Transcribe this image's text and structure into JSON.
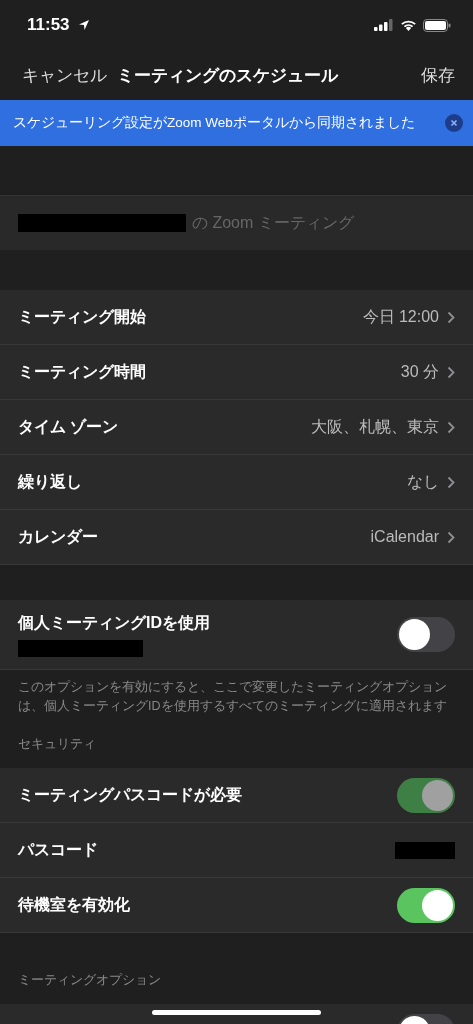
{
  "status_bar": {
    "time": "11:53"
  },
  "nav": {
    "cancel": "キャンセル",
    "title": "ミーティングのスケジュール",
    "save": "保存"
  },
  "banner": {
    "text": "スケジューリング設定がZoom Webポータルから同期されました"
  },
  "topic": {
    "redacted": true,
    "suffix": "の Zoom ミーティング"
  },
  "settings": [
    {
      "label": "ミーティング開始",
      "value": "今日 12:00"
    },
    {
      "label": "ミーティング時間",
      "value": "30 分"
    },
    {
      "label": "タイム ゾーン",
      "value": "大阪、札幌、東京"
    },
    {
      "label": "繰り返し",
      "value": "なし"
    },
    {
      "label": "カレンダー",
      "value": "iCalendar"
    }
  ],
  "personal_id": {
    "label": "個人ミーティングIDを使用",
    "redacted": true,
    "on": false,
    "note": "このオプションを有効にすると、ここで変更したミーティングオプションは、個人ミーティングIDを使用するすべてのミーティングに適用されます"
  },
  "security": {
    "header": "セキュリティ",
    "rows": [
      {
        "kind": "toggle",
        "label": "ミーティングパスコードが必要",
        "on": true,
        "disabled": true
      },
      {
        "kind": "secret",
        "label": "パスコード",
        "redacted": true
      },
      {
        "kind": "toggle",
        "label": "待機室を有効化",
        "on": true,
        "disabled": false
      }
    ]
  },
  "options": {
    "header": "ミーティングオプション",
    "rows": [
      {
        "kind": "toggle",
        "on": false,
        "disabled": false
      }
    ]
  }
}
